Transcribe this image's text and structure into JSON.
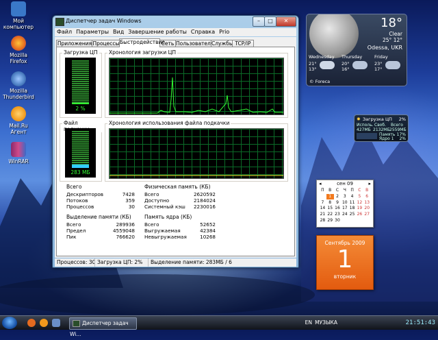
{
  "desktop": {
    "icons": [
      {
        "label": "Мой компьютер",
        "color": "#3a78c8"
      },
      {
        "label": "Mozilla Firefox",
        "color": "#e56b1f"
      },
      {
        "label": "Mozilla Thunderbird",
        "color": "#4b7ec2"
      },
      {
        "label": "Mail.Ru Агент",
        "color": "#f29a1c"
      },
      {
        "label": "WinRAR",
        "color": "#8b2a6b"
      }
    ]
  },
  "window": {
    "title": "Диспетчер задач Windows",
    "menu": [
      "Файл",
      "Параметры",
      "Вид",
      "Завершение работы",
      "Справка",
      "Prio"
    ],
    "tabs": [
      "Приложения",
      "Процессы",
      "Быстродействие",
      "Сеть",
      "Пользователи",
      "Службы",
      "TCP/IP"
    ],
    "active_tab": "Быстродействие",
    "cpu_label": "Загрузка ЦП",
    "cpu_history_label": "Хронология загрузки ЦП",
    "cpu_usage": "2 %",
    "cpu_fraction": 0.02,
    "pf_label": "Файл подкачки",
    "pf_history_label": "Хронология использования файла подкачки",
    "pf_usage": "283 МБ",
    "pf_fraction": 0.1,
    "totals": {
      "title": "Всего",
      "rows": [
        {
          "k": "Дескрипторов",
          "v": "7428"
        },
        {
          "k": "Потоков",
          "v": "359"
        },
        {
          "k": "Процессов",
          "v": "30"
        }
      ]
    },
    "physical": {
      "title": "Физическая память (КБ)",
      "rows": [
        {
          "k": "Всего",
          "v": "2620592"
        },
        {
          "k": "Доступно",
          "v": "2184024"
        },
        {
          "k": "Системный кэш",
          "v": "2230016"
        }
      ]
    },
    "commit": {
      "title": "Выделение памяти (КБ)",
      "rows": [
        {
          "k": "Всего",
          "v": "289936"
        },
        {
          "k": "Предел",
          "v": "4559048"
        },
        {
          "k": "Пик",
          "v": "766620"
        }
      ]
    },
    "kernel": {
      "title": "Память ядра (КБ)",
      "rows": [
        {
          "k": "Всего",
          "v": "52652"
        },
        {
          "k": "Выгружаемая",
          "v": "42384"
        },
        {
          "k": "Невыгружаемая",
          "v": "10268"
        }
      ]
    },
    "status": {
      "processes": "Процессов: 30",
      "cpu": "Загрузка ЦП: 2%",
      "commit": "Выделение памяти: 283МБ / 6"
    }
  },
  "weather": {
    "temp": "18°",
    "condition": "Clear",
    "hilo": "25° 12°",
    "city": "Odessa, UKR",
    "credit": "© Foreca",
    "days": [
      {
        "name": "Wednesday",
        "hi": "21°",
        "lo": "13°"
      },
      {
        "name": "Thursday",
        "hi": "20°",
        "lo": "16°"
      },
      {
        "name": "Friday",
        "hi": "23°",
        "lo": "17°"
      }
    ]
  },
  "cpu_gadget": {
    "title": "Загрузка ЦП",
    "value": "2%",
    "col_labels": [
      "Исполь.",
      "Своб.",
      "Всего"
    ],
    "col_values": [
      "427МБ",
      "2132МБ",
      "2559МБ"
    ],
    "mem_label": "Память",
    "mem_value": "17%",
    "core_label": "Ядро 1",
    "core_value": "2%"
  },
  "calendar": {
    "month": "сен 09",
    "weekdays": [
      "П",
      "В",
      "С",
      "Ч",
      "П",
      "С",
      "В"
    ],
    "weeks": [
      [
        "",
        "1",
        "2",
        "3",
        "4",
        "5",
        "6"
      ],
      [
        "7",
        "8",
        "9",
        "10",
        "11",
        "12",
        "13"
      ],
      [
        "14",
        "15",
        "16",
        "17",
        "18",
        "19",
        "20"
      ],
      [
        "21",
        "22",
        "23",
        "24",
        "25",
        "26",
        "27"
      ],
      [
        "28",
        "29",
        "30",
        "",
        "",
        "",
        ""
      ]
    ],
    "today": "1"
  },
  "daypage": {
    "month_year": "Сентябрь 2009",
    "day": "1",
    "weekday": "вторник"
  },
  "taskbar": {
    "task_label": "Диспетчер задач Wi...",
    "lang": "EN",
    "music": "МУЗЫКА",
    "clock": "21:51:43"
  }
}
